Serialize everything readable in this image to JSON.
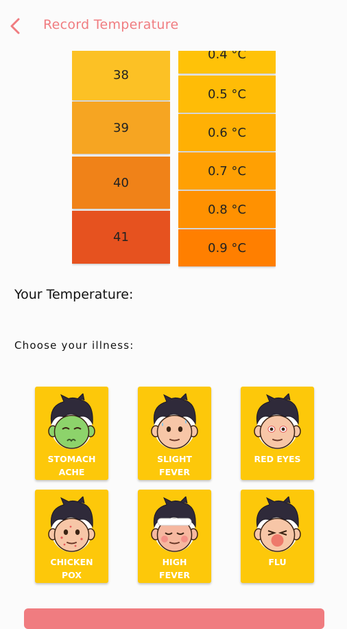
{
  "header": {
    "title": "Record Temperature"
  },
  "picker": {
    "degrees": [
      "38",
      "39",
      "40",
      "41"
    ],
    "decimals": [
      "0.4 °C",
      "0.5 °C",
      "0.6 °C",
      "0.7 °C",
      "0.8 °C",
      "0.9 °C"
    ],
    "degree_colors": [
      "#fcc125",
      "#f6a522",
      "#f08218",
      "#e6521f"
    ],
    "decimal_colors": [
      "#ffc208",
      "#ffbc06",
      "#ffb004",
      "#ffa003",
      "#ff9101",
      "#ff7f00"
    ]
  },
  "labels": {
    "your_temperature": "Your Temperature:",
    "choose_illness": "Choose your illness:"
  },
  "illnesses": [
    {
      "label": "STOMACH\nACHE",
      "skin": "#8dd36b",
      "marks": "sick"
    },
    {
      "label": "SLIGHT\nFEVER",
      "skin": "#f7c6a7",
      "marks": "sweat"
    },
    {
      "label": "RED EYES",
      "skin": "#f7c6a7",
      "marks": "redeyes"
    },
    {
      "label": "CHICKEN\nPOX",
      "skin": "#f7c6a7",
      "marks": "pox"
    },
    {
      "label": "HIGH\nFEVER",
      "skin": "#f6b8a0",
      "marks": "towel"
    },
    {
      "label": "FLU",
      "skin": "#f7c6a7",
      "marks": "flu"
    }
  ],
  "colors": {
    "accent": "#f07c80",
    "card": "#fdc80a"
  }
}
